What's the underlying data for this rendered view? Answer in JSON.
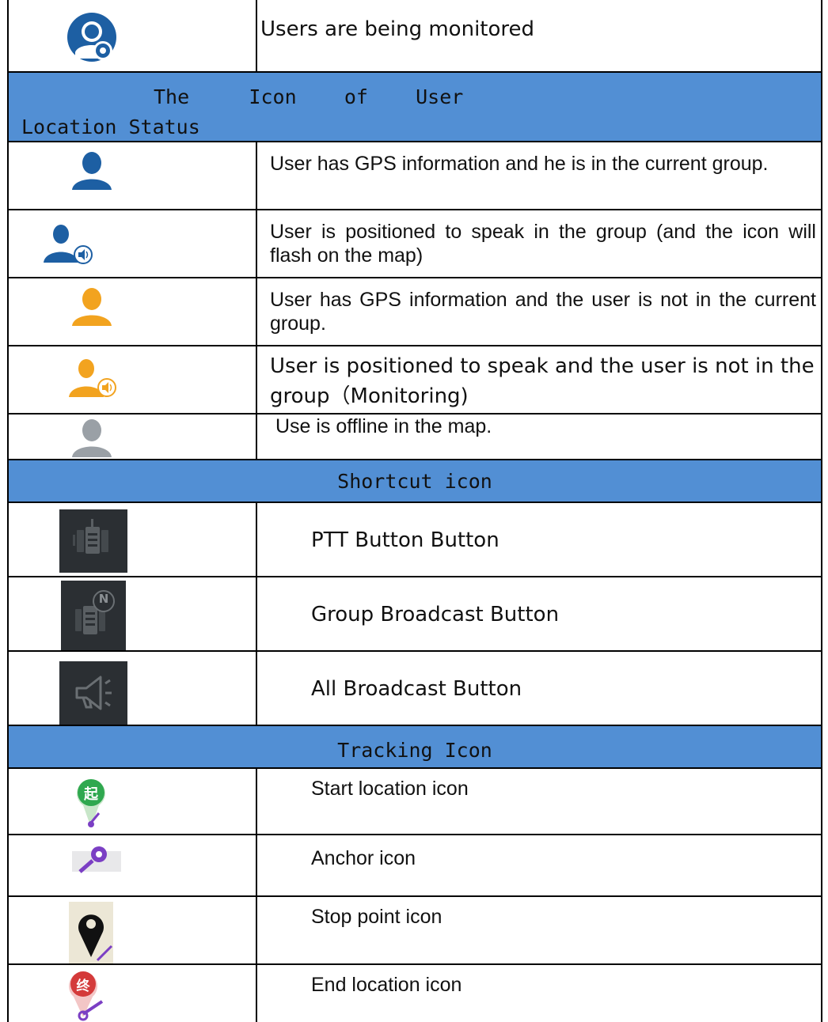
{
  "rows": {
    "monitored": {
      "description": "Users are being monitored"
    },
    "location_header": {
      "line1": "The     Icon    of    User",
      "line2": "Location Status"
    },
    "gps_current": {
      "description": "User has GPS information and he is in the current group."
    },
    "speak_group": {
      "description": "User is positioned to speak in the group (and the icon will flash on the map)"
    },
    "gps_not_current": {
      "description": "User has GPS information and the user is not in the current group."
    },
    "speak_not_group": {
      "description": "User is positioned to speak and the user is not in the group（Monitoring)"
    },
    "offline": {
      "description": " Use is offline in the map."
    },
    "shortcut_header": {
      "title": "Shortcut icon"
    },
    "ptt": {
      "description": "PTT Button Button"
    },
    "group_broadcast": {
      "description": "Group Broadcast Button",
      "badge": "N"
    },
    "all_broadcast": {
      "description": "All Broadcast Button"
    },
    "tracking_header": {
      "title": "Tracking Icon"
    },
    "start": {
      "description": "Start location icon",
      "badge": "起"
    },
    "anchor": {
      "description": "Anchor icon"
    },
    "stop": {
      "description": "Stop point icon"
    },
    "end": {
      "description": "End location icon",
      "badge": "终"
    }
  },
  "colors": {
    "header_bg": "#528fd4",
    "user_blue": "#1d5fa3",
    "user_orange": "#f2a31f",
    "user_gray": "#9aa0a6",
    "dark_icon_bg": "#2b2f33",
    "start_green": "#2fa84f",
    "end_red": "#d43a3a",
    "anchor_purple": "#7b3fc4"
  },
  "icons": [
    "monitored-user-icon",
    "user-blue-icon",
    "user-blue-speaking-icon",
    "user-orange-icon",
    "user-orange-speaking-icon",
    "user-gray-icon",
    "ptt-icon",
    "group-broadcast-icon",
    "all-broadcast-icon",
    "start-location-icon",
    "anchor-icon",
    "stop-point-icon",
    "end-location-icon"
  ]
}
